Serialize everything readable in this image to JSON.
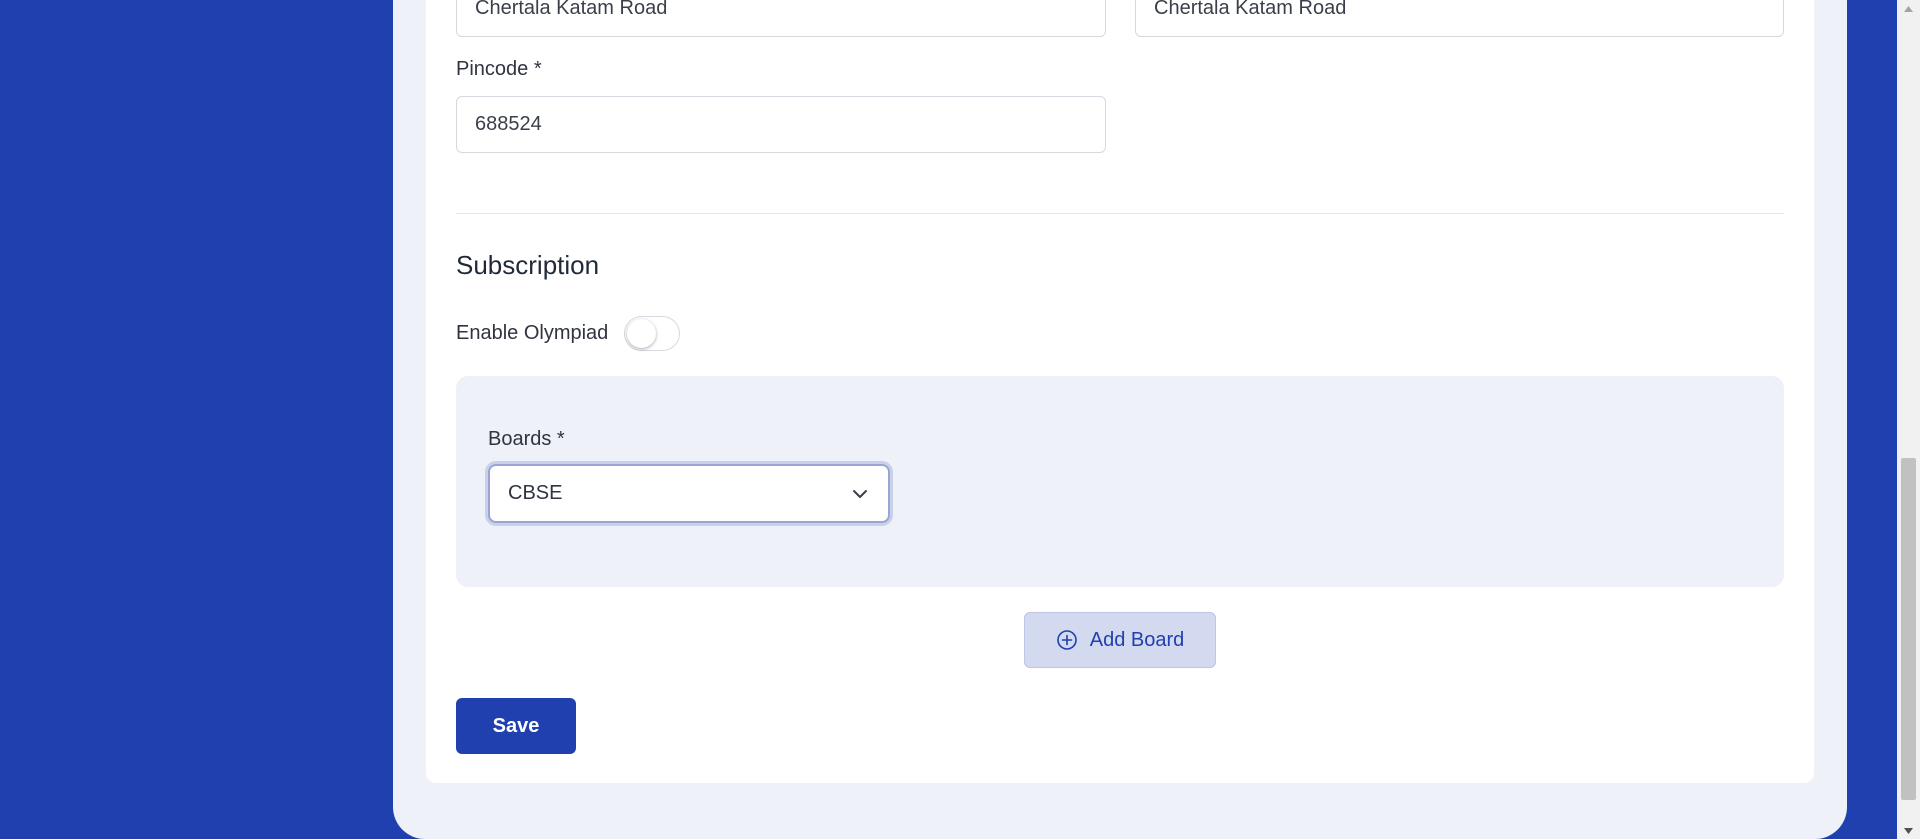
{
  "address": {
    "line_left_value": "Chertala Katam Road",
    "line_right_value": "Chertala Katam Road"
  },
  "pincode": {
    "label": "Pincode *",
    "value": "688524"
  },
  "subscription": {
    "title": "Subscription",
    "olympiad_label": "Enable Olympiad",
    "olympiad_enabled": false
  },
  "boards": {
    "label": "Boards *",
    "selected": "CBSE"
  },
  "actions": {
    "add_board_label": "Add Board",
    "save_label": "Save"
  },
  "colors": {
    "primary": "#1f40ae",
    "panel_bg": "#eef1f7",
    "add_board_bg": "#d3d9ef"
  },
  "icons": {
    "add": "plus-circle-icon",
    "dropdown": "chevron-down-icon"
  }
}
